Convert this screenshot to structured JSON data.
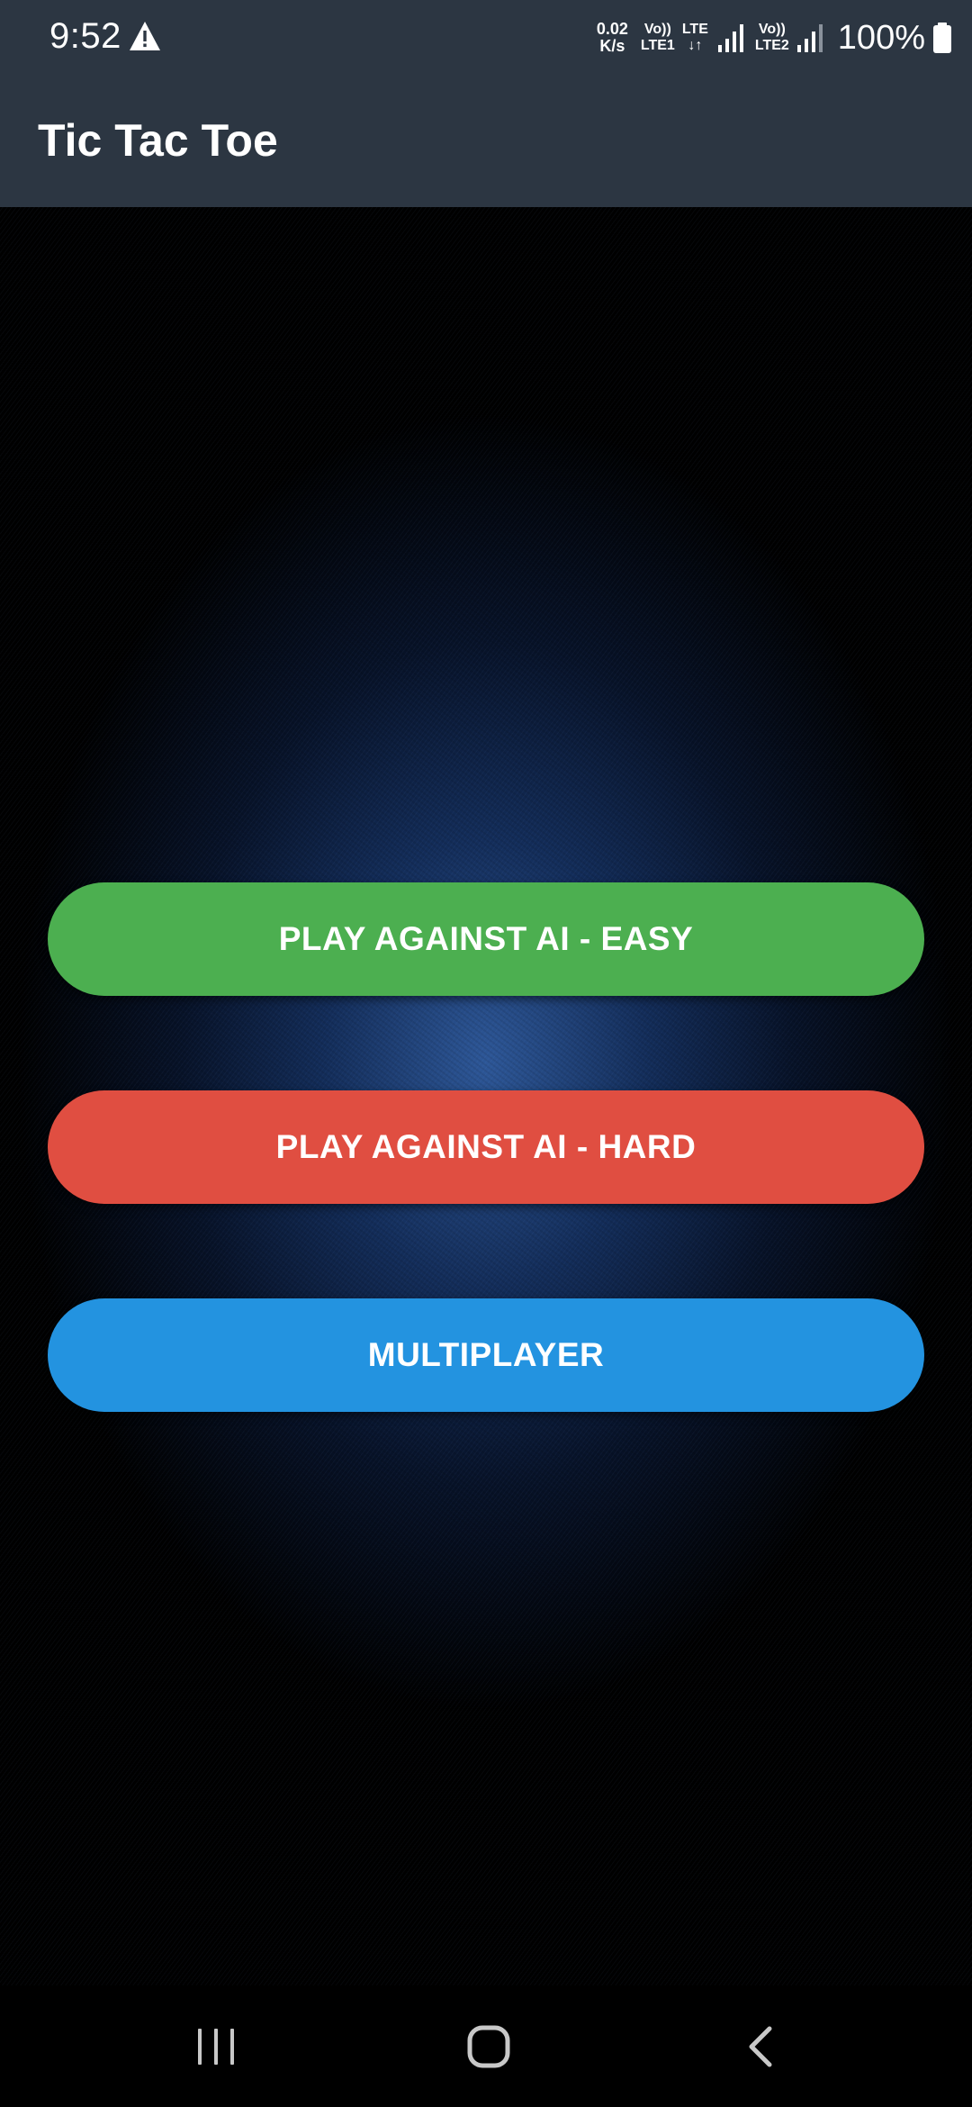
{
  "status_bar": {
    "time": "9:52",
    "net_speed_value": "0.02",
    "net_speed_unit": "K/s",
    "sim1_top": "Vo))",
    "sim1_bottom": "LTE1",
    "lte_top": "LTE",
    "lte_bottom": "↓↑",
    "sim2_top": "Vo))",
    "sim2_bottom": "LTE2",
    "battery": "100%",
    "icons": [
      "warning-icon",
      "signal-icon",
      "signal-icon",
      "battery-icon"
    ]
  },
  "app_bar": {
    "title": "Tic Tac Toe"
  },
  "menu": {
    "easy_label": "PLAY AGAINST AI - EASY",
    "hard_label": "PLAY AGAINST AI - HARD",
    "multiplayer_label": "MULTIPLAYER"
  },
  "colors": {
    "app_bar": "#2c3642",
    "easy": "#4caf50",
    "hard": "#e04e41",
    "multiplayer": "#2393e0",
    "background_glow": "#305ca0"
  },
  "nav_bar": {
    "icons": [
      "recent-apps-icon",
      "home-icon",
      "back-icon"
    ]
  }
}
